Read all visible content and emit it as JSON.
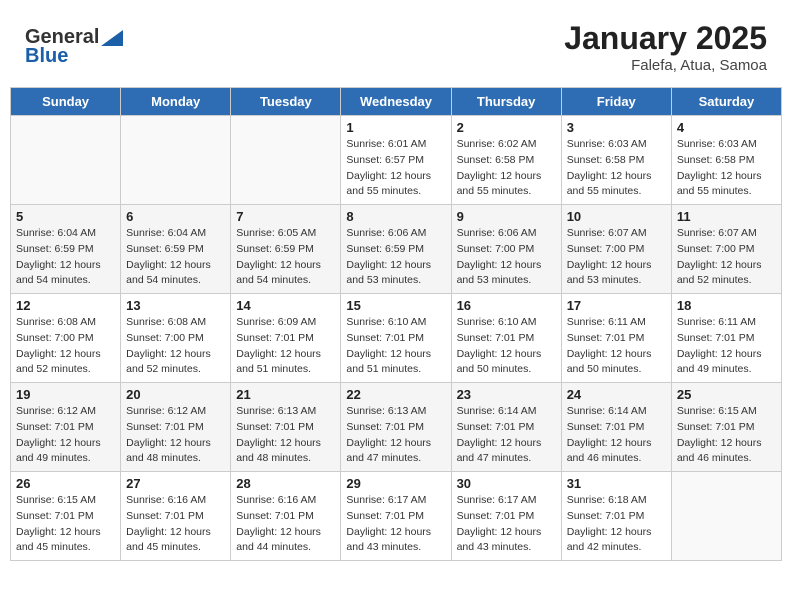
{
  "header": {
    "logo_general": "General",
    "logo_blue": "Blue",
    "month_title": "January 2025",
    "location": "Falefa, Atua, Samoa"
  },
  "weekdays": [
    "Sunday",
    "Monday",
    "Tuesday",
    "Wednesday",
    "Thursday",
    "Friday",
    "Saturday"
  ],
  "weeks": [
    [
      {
        "day": "",
        "sunrise": "",
        "sunset": "",
        "daylight": ""
      },
      {
        "day": "",
        "sunrise": "",
        "sunset": "",
        "daylight": ""
      },
      {
        "day": "",
        "sunrise": "",
        "sunset": "",
        "daylight": ""
      },
      {
        "day": "1",
        "sunrise": "Sunrise: 6:01 AM",
        "sunset": "Sunset: 6:57 PM",
        "daylight": "Daylight: 12 hours and 55 minutes."
      },
      {
        "day": "2",
        "sunrise": "Sunrise: 6:02 AM",
        "sunset": "Sunset: 6:58 PM",
        "daylight": "Daylight: 12 hours and 55 minutes."
      },
      {
        "day": "3",
        "sunrise": "Sunrise: 6:03 AM",
        "sunset": "Sunset: 6:58 PM",
        "daylight": "Daylight: 12 hours and 55 minutes."
      },
      {
        "day": "4",
        "sunrise": "Sunrise: 6:03 AM",
        "sunset": "Sunset: 6:58 PM",
        "daylight": "Daylight: 12 hours and 55 minutes."
      }
    ],
    [
      {
        "day": "5",
        "sunrise": "Sunrise: 6:04 AM",
        "sunset": "Sunset: 6:59 PM",
        "daylight": "Daylight: 12 hours and 54 minutes."
      },
      {
        "day": "6",
        "sunrise": "Sunrise: 6:04 AM",
        "sunset": "Sunset: 6:59 PM",
        "daylight": "Daylight: 12 hours and 54 minutes."
      },
      {
        "day": "7",
        "sunrise": "Sunrise: 6:05 AM",
        "sunset": "Sunset: 6:59 PM",
        "daylight": "Daylight: 12 hours and 54 minutes."
      },
      {
        "day": "8",
        "sunrise": "Sunrise: 6:06 AM",
        "sunset": "Sunset: 6:59 PM",
        "daylight": "Daylight: 12 hours and 53 minutes."
      },
      {
        "day": "9",
        "sunrise": "Sunrise: 6:06 AM",
        "sunset": "Sunset: 7:00 PM",
        "daylight": "Daylight: 12 hours and 53 minutes."
      },
      {
        "day": "10",
        "sunrise": "Sunrise: 6:07 AM",
        "sunset": "Sunset: 7:00 PM",
        "daylight": "Daylight: 12 hours and 53 minutes."
      },
      {
        "day": "11",
        "sunrise": "Sunrise: 6:07 AM",
        "sunset": "Sunset: 7:00 PM",
        "daylight": "Daylight: 12 hours and 52 minutes."
      }
    ],
    [
      {
        "day": "12",
        "sunrise": "Sunrise: 6:08 AM",
        "sunset": "Sunset: 7:00 PM",
        "daylight": "Daylight: 12 hours and 52 minutes."
      },
      {
        "day": "13",
        "sunrise": "Sunrise: 6:08 AM",
        "sunset": "Sunset: 7:00 PM",
        "daylight": "Daylight: 12 hours and 52 minutes."
      },
      {
        "day": "14",
        "sunrise": "Sunrise: 6:09 AM",
        "sunset": "Sunset: 7:01 PM",
        "daylight": "Daylight: 12 hours and 51 minutes."
      },
      {
        "day": "15",
        "sunrise": "Sunrise: 6:10 AM",
        "sunset": "Sunset: 7:01 PM",
        "daylight": "Daylight: 12 hours and 51 minutes."
      },
      {
        "day": "16",
        "sunrise": "Sunrise: 6:10 AM",
        "sunset": "Sunset: 7:01 PM",
        "daylight": "Daylight: 12 hours and 50 minutes."
      },
      {
        "day": "17",
        "sunrise": "Sunrise: 6:11 AM",
        "sunset": "Sunset: 7:01 PM",
        "daylight": "Daylight: 12 hours and 50 minutes."
      },
      {
        "day": "18",
        "sunrise": "Sunrise: 6:11 AM",
        "sunset": "Sunset: 7:01 PM",
        "daylight": "Daylight: 12 hours and 49 minutes."
      }
    ],
    [
      {
        "day": "19",
        "sunrise": "Sunrise: 6:12 AM",
        "sunset": "Sunset: 7:01 PM",
        "daylight": "Daylight: 12 hours and 49 minutes."
      },
      {
        "day": "20",
        "sunrise": "Sunrise: 6:12 AM",
        "sunset": "Sunset: 7:01 PM",
        "daylight": "Daylight: 12 hours and 48 minutes."
      },
      {
        "day": "21",
        "sunrise": "Sunrise: 6:13 AM",
        "sunset": "Sunset: 7:01 PM",
        "daylight": "Daylight: 12 hours and 48 minutes."
      },
      {
        "day": "22",
        "sunrise": "Sunrise: 6:13 AM",
        "sunset": "Sunset: 7:01 PM",
        "daylight": "Daylight: 12 hours and 47 minutes."
      },
      {
        "day": "23",
        "sunrise": "Sunrise: 6:14 AM",
        "sunset": "Sunset: 7:01 PM",
        "daylight": "Daylight: 12 hours and 47 minutes."
      },
      {
        "day": "24",
        "sunrise": "Sunrise: 6:14 AM",
        "sunset": "Sunset: 7:01 PM",
        "daylight": "Daylight: 12 hours and 46 minutes."
      },
      {
        "day": "25",
        "sunrise": "Sunrise: 6:15 AM",
        "sunset": "Sunset: 7:01 PM",
        "daylight": "Daylight: 12 hours and 46 minutes."
      }
    ],
    [
      {
        "day": "26",
        "sunrise": "Sunrise: 6:15 AM",
        "sunset": "Sunset: 7:01 PM",
        "daylight": "Daylight: 12 hours and 45 minutes."
      },
      {
        "day": "27",
        "sunrise": "Sunrise: 6:16 AM",
        "sunset": "Sunset: 7:01 PM",
        "daylight": "Daylight: 12 hours and 45 minutes."
      },
      {
        "day": "28",
        "sunrise": "Sunrise: 6:16 AM",
        "sunset": "Sunset: 7:01 PM",
        "daylight": "Daylight: 12 hours and 44 minutes."
      },
      {
        "day": "29",
        "sunrise": "Sunrise: 6:17 AM",
        "sunset": "Sunset: 7:01 PM",
        "daylight": "Daylight: 12 hours and 43 minutes."
      },
      {
        "day": "30",
        "sunrise": "Sunrise: 6:17 AM",
        "sunset": "Sunset: 7:01 PM",
        "daylight": "Daylight: 12 hours and 43 minutes."
      },
      {
        "day": "31",
        "sunrise": "Sunrise: 6:18 AM",
        "sunset": "Sunset: 7:01 PM",
        "daylight": "Daylight: 12 hours and 42 minutes."
      },
      {
        "day": "",
        "sunrise": "",
        "sunset": "",
        "daylight": ""
      }
    ]
  ]
}
